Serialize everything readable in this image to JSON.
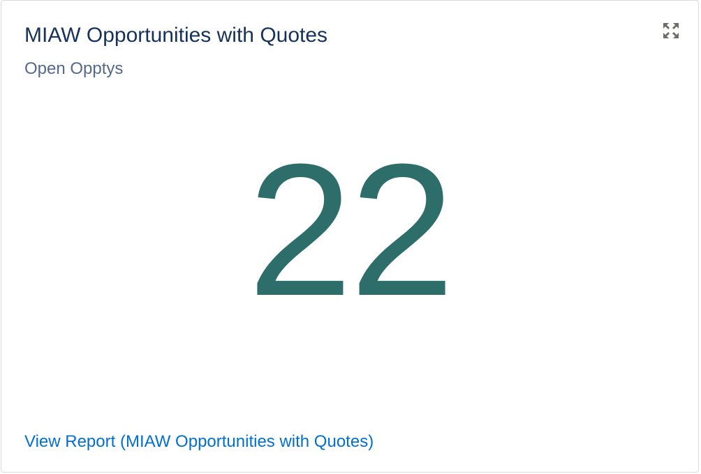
{
  "card": {
    "title": "MIAW Opportunities with Quotes",
    "subtitle": "Open Opptys",
    "metric_value": "22",
    "footer_link": "View Report (MIAW Opportunities with Quotes)",
    "expand_icon": "expand-icon"
  },
  "colors": {
    "title": "#16325c",
    "subtitle": "#54698d",
    "metric": "#2e6e6a",
    "link": "#0070d2",
    "border": "#dddbda"
  }
}
